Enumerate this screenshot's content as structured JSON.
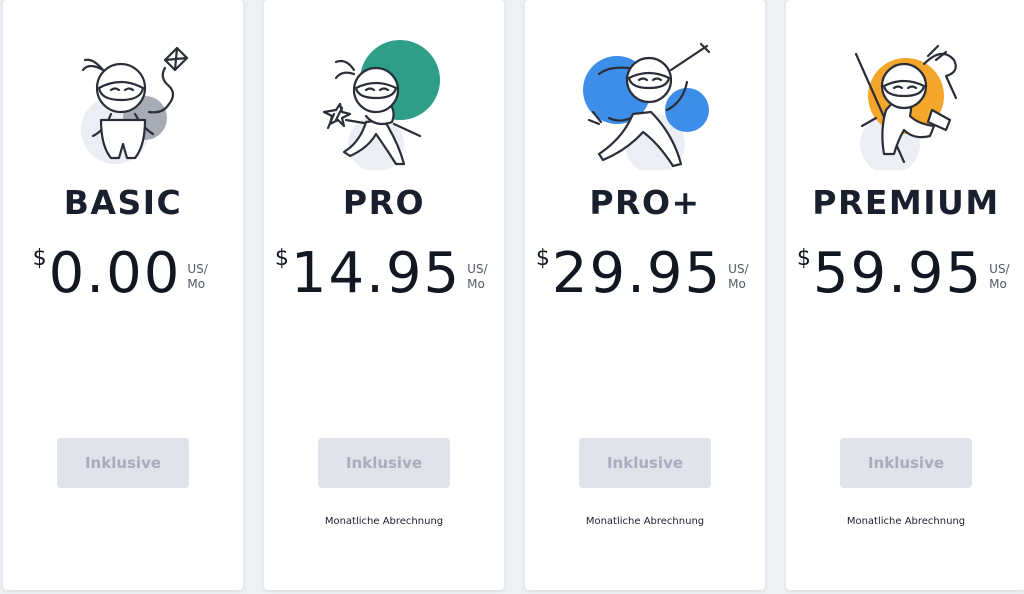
{
  "plans": [
    {
      "name": "BASIC",
      "currency": "$",
      "price": "0.00",
      "unit_top": "US/",
      "unit_bottom": "Mo",
      "button_label": "Inklusive",
      "billing_note": "",
      "accent_color": "#9ea2aa"
    },
    {
      "name": "PRO",
      "currency": "$",
      "price": "14.95",
      "unit_top": "US/",
      "unit_bottom": "Mo",
      "button_label": "Inklusive",
      "billing_note": "Monatliche Abrechnung",
      "accent_color": "#2e9e88"
    },
    {
      "name": "PRO+",
      "currency": "$",
      "price": "29.95",
      "unit_top": "US/",
      "unit_bottom": "Mo",
      "button_label": "Inklusive",
      "billing_note": "Monatliche Abrechnung",
      "accent_color": "#3d8ee8"
    },
    {
      "name": "PREMIUM",
      "currency": "$",
      "price": "59.95",
      "unit_top": "US/",
      "unit_bottom": "Mo",
      "button_label": "Inklusive",
      "billing_note": "Monatliche Abrechnung",
      "accent_color": "#f4a62a"
    }
  ],
  "icons": [
    "ninja-kite-icon",
    "ninja-shuriken-icon",
    "ninja-sword-icon",
    "ninja-staff-icon"
  ]
}
